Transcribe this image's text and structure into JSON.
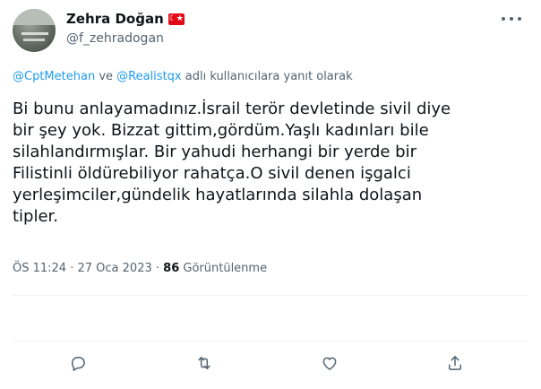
{
  "author": {
    "display_name": "Zehra Doğan",
    "flag": "☾★",
    "handle": "@f_zehradogan"
  },
  "reply_context": {
    "user1": "@CptMetehan",
    "connector": " ve ",
    "user2": "@Realistqx",
    "suffix": " adlı kullanıcılara yanıt olarak"
  },
  "tweet": {
    "text": "Bi bunu anlayamadınız.İsrail terör devletinde sivil diye\nbir şey yok. Bizzat gittim,gördüm.Yaşlı kadınları bile\nsilahlandırmışlar. Bir yahudi herhangi bir yerde bir\nFilistinli öldürebiliyor rahatça.O sivil denen işgalci\nyerleşimciler,gündelik hayatlarında silahla dolaşan\ntipler.",
    "time": "ÖS 11:24",
    "separator": " · ",
    "date": "27 Oca 2023",
    "views_count": "86",
    "views_label": " Görüntülenme"
  },
  "actions": {
    "icons": [
      "reply-icon",
      "retweet-icon",
      "like-icon",
      "share-icon"
    ]
  },
  "colors": {
    "link": "#1d9bf0",
    "secondary_text": "#536471",
    "primary_text": "#0f1419",
    "flag_red": "#e30a17"
  }
}
